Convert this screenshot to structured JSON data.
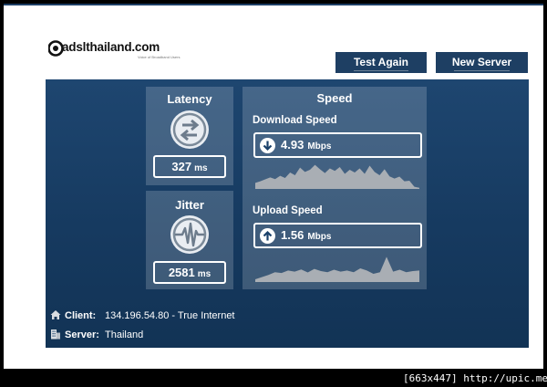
{
  "logo": {
    "text": "adslthailand.com",
    "tagline": "Voice of Broadband Users"
  },
  "buttons": {
    "test_again": "Test Again",
    "new_server": "New Server"
  },
  "latency": {
    "title": "Latency",
    "value": "327",
    "unit": "ms"
  },
  "jitter": {
    "title": "Jitter",
    "value": "2581",
    "unit": "ms"
  },
  "speed": {
    "title": "Speed",
    "download": {
      "label": "Download Speed",
      "value": "4.93",
      "unit": "Mbps",
      "graph": [
        0.22,
        0.28,
        0.35,
        0.42,
        0.36,
        0.48,
        0.4,
        0.6,
        0.5,
        0.78,
        0.62,
        0.7,
        0.88,
        0.72,
        0.58,
        0.75,
        0.66,
        0.8,
        0.55,
        0.7,
        0.6,
        0.75,
        0.55,
        0.85,
        0.62,
        0.5,
        0.72,
        0.46,
        0.38,
        0.45,
        0.28,
        0.3,
        0.08,
        0.04
      ]
    },
    "upload": {
      "label": "Upload Speed",
      "value": "1.56",
      "unit": "Mbps",
      "graph": [
        0.1,
        0.18,
        0.26,
        0.36,
        0.33,
        0.42,
        0.38,
        0.46,
        0.35,
        0.48,
        0.4,
        0.36,
        0.45,
        0.38,
        0.42,
        0.36,
        0.5,
        0.42,
        0.3,
        0.36,
        0.92,
        0.38,
        0.45,
        0.36,
        0.4,
        0.42
      ]
    }
  },
  "info": {
    "client_label": "Client:",
    "client_value": "134.196.54.80 - True Internet",
    "server_label": "Server:",
    "server_value": "Thailand"
  },
  "icons": {
    "latency": "arrows-swap-icon",
    "jitter": "waveform-icon",
    "download": "arrow-down-icon",
    "upload": "arrow-up-icon",
    "client": "home-icon",
    "server": "building-icon"
  },
  "colors": {
    "accent": "#1e3f63",
    "panel": "#1a416a",
    "graph_fill": "#a9aeb4"
  },
  "watermark": "[663x447] http://upic.me/"
}
